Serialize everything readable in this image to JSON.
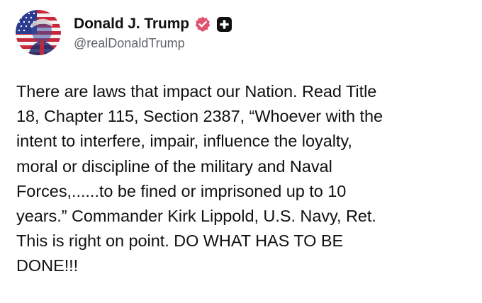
{
  "author": {
    "display_name": "Donald J. Trump",
    "handle": "@realDonaldTrump",
    "avatar_icon": "profile-photo-flag-avatar",
    "verified_icon": "verified-badge-icon",
    "verified_color": "#e0526e",
    "plus_icon": "subscriber-plus-icon"
  },
  "post": {
    "lines": [
      "There are laws that impact our Nation. Read Title",
      "18, Chapter 115, Section 2387, “Whoever with the",
      "intent to interfere, impair, influence the loyalty,",
      "moral or discipline of the military and Naval",
      "Forces,......to be fined or imprisoned up to 10",
      "years.” Commander Kirk Lippold, U.S. Navy, Ret.",
      "This is right on point. DO WHAT HAS TO BE",
      "DONE!!!"
    ]
  }
}
